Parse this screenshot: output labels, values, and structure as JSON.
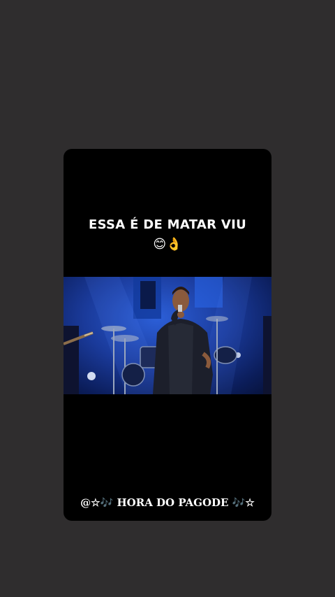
{
  "story": {
    "caption": "ESSA É DE MATAR VIU",
    "emojis": "😊👌",
    "footer": {
      "prefix": "@☆",
      "note_left": "🎶",
      "title": " HORA DO PAGODE ",
      "note_right": "🎶",
      "suffix": "☆"
    },
    "video": {
      "scene": "stage-performance",
      "colors": {
        "stage_blue": "#1a3a9a",
        "light": "#cfe0ff"
      }
    }
  }
}
